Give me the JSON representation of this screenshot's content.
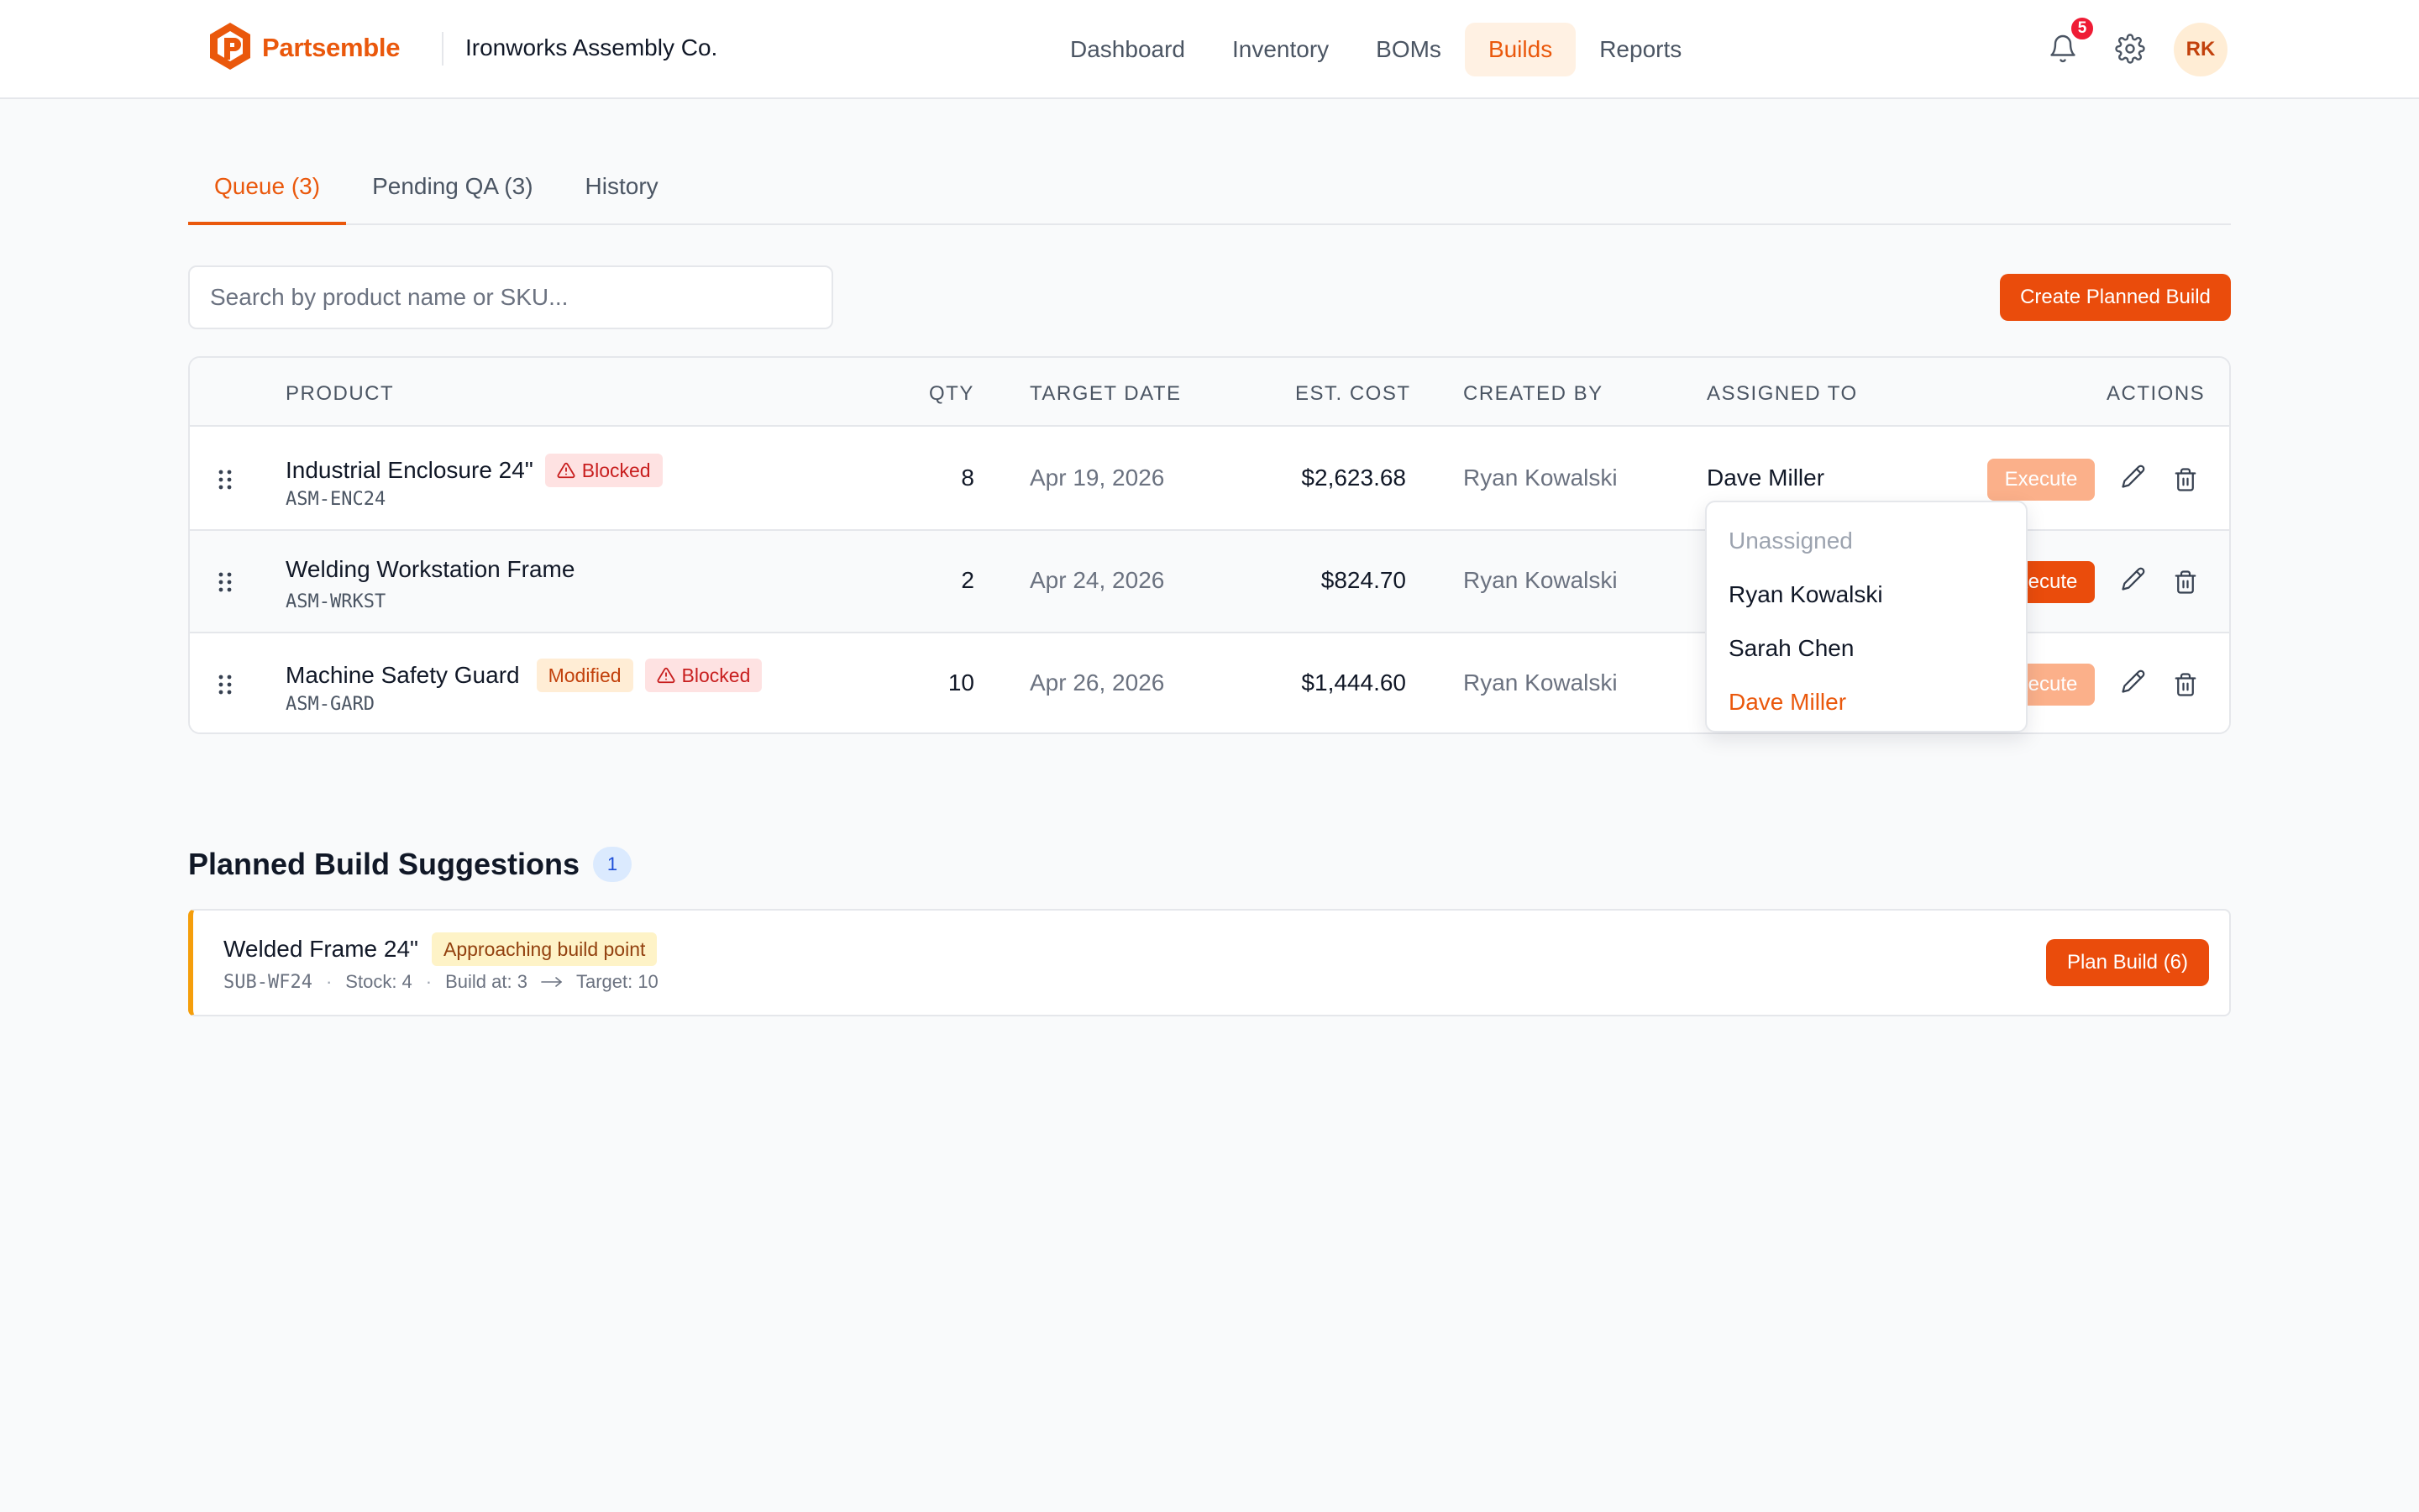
{
  "app": {
    "name": "Partsemble",
    "company": "Ironworks Assembly Co."
  },
  "nav": {
    "items": [
      {
        "label": "Dashboard",
        "active": false
      },
      {
        "label": "Inventory",
        "active": false
      },
      {
        "label": "BOMs",
        "active": false
      },
      {
        "label": "Builds",
        "active": true
      },
      {
        "label": "Reports",
        "active": false
      }
    ]
  },
  "header": {
    "notification_count": "5",
    "avatar_initials": "RK"
  },
  "tabs": [
    {
      "label": "Queue (3)",
      "active": true
    },
    {
      "label": "Pending QA (3)",
      "active": false
    },
    {
      "label": "History",
      "active": false
    }
  ],
  "search": {
    "placeholder": "Search by product name or SKU...",
    "value": ""
  },
  "create_button": "Create Planned Build",
  "table": {
    "headers": {
      "product": "PRODUCT",
      "qty": "QTY",
      "target_date": "TARGET DATE",
      "est_cost": "EST. COST",
      "created_by": "CREATED BY",
      "assigned_to": "ASSIGNED TO",
      "actions": "ACTIONS"
    },
    "rows": [
      {
        "name": "Industrial Enclosure 24\"",
        "sku": "ASM-ENC24",
        "badges": [
          "Blocked"
        ],
        "qty": "8",
        "target_date": "Apr 19, 2026",
        "est_cost": "$2,623.68",
        "created_by": "Ryan Kowalski",
        "assigned_to": "Dave Miller",
        "execute_label": "Execute",
        "execute_enabled": false
      },
      {
        "name": "Welding Workstation Frame",
        "sku": "ASM-WRKST",
        "badges": [],
        "qty": "2",
        "target_date": "Apr 24, 2026",
        "est_cost": "$824.70",
        "created_by": "Ryan Kowalski",
        "assigned_to": "",
        "execute_label": "Execute",
        "execute_enabled": true
      },
      {
        "name": "Machine Safety Guard",
        "sku": "ASM-GARD",
        "badges": [
          "Modified",
          "Blocked"
        ],
        "qty": "10",
        "target_date": "Apr 26, 2026",
        "est_cost": "$1,444.60",
        "created_by": "Ryan Kowalski",
        "assigned_to": "",
        "execute_label": "Execute",
        "execute_enabled": false
      }
    ]
  },
  "assign_dropdown": {
    "options": [
      "Unassigned",
      "Ryan Kowalski",
      "Sarah Chen",
      "Dave Miller"
    ],
    "selected": "Dave Miller"
  },
  "suggestions": {
    "title": "Planned Build Suggestions",
    "count": "1",
    "items": [
      {
        "name": "Welded Frame 24\"",
        "badge": "Approaching build point",
        "sku": "SUB-WF24",
        "stock": "Stock: 4",
        "build_at": "Build at: 3",
        "target": "Target: 10",
        "button": "Plan Build (6)"
      }
    ]
  },
  "colors": {
    "accent": "#ea580c",
    "button": "#ea4c0c",
    "blocked_bg": "#fee2e2",
    "blocked_text": "#c81e1e",
    "modified_bg": "#ffedd5",
    "approaching_bg": "#fef3c7",
    "suggestion_border": "#f59e0b"
  },
  "icons": [
    "logo-icon",
    "bell-icon",
    "gear-icon",
    "drag-handle-icon",
    "warning-icon",
    "pencil-icon",
    "trash-icon",
    "arrow-right-icon"
  ]
}
